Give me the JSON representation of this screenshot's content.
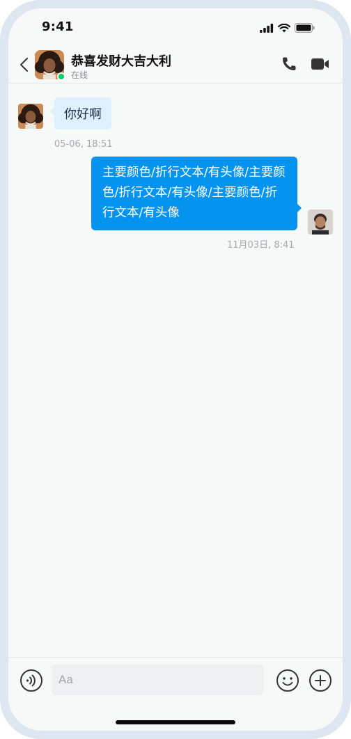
{
  "status_bar": {
    "time": "9:41",
    "icons": [
      "signal-icon",
      "wifi-icon",
      "battery-icon"
    ]
  },
  "header": {
    "back_icon": "chevron-left-icon",
    "contact_name": "恭喜发财大吉大利",
    "contact_status": "在线",
    "actions": [
      "phone-icon",
      "video-camera-icon"
    ]
  },
  "messages": [
    {
      "direction": "incoming",
      "text": "你好啊",
      "time": "05-06, 18:51"
    },
    {
      "direction": "outgoing",
      "text": "主要颜色/折行文本/有头像/主要颜色/折行文本/有头像/主要颜色/折行文本/有头像",
      "time": "11月03日, 8:41"
    }
  ],
  "input_bar": {
    "placeholder": "Aa",
    "icons": [
      "voice-icon",
      "emoji-icon",
      "plus-icon"
    ]
  },
  "colors": {
    "outgoing_bubble": "#0593f0",
    "incoming_bubble": "#def0fd",
    "online_dot": "#00d26a",
    "background": "#f7f8f8"
  }
}
